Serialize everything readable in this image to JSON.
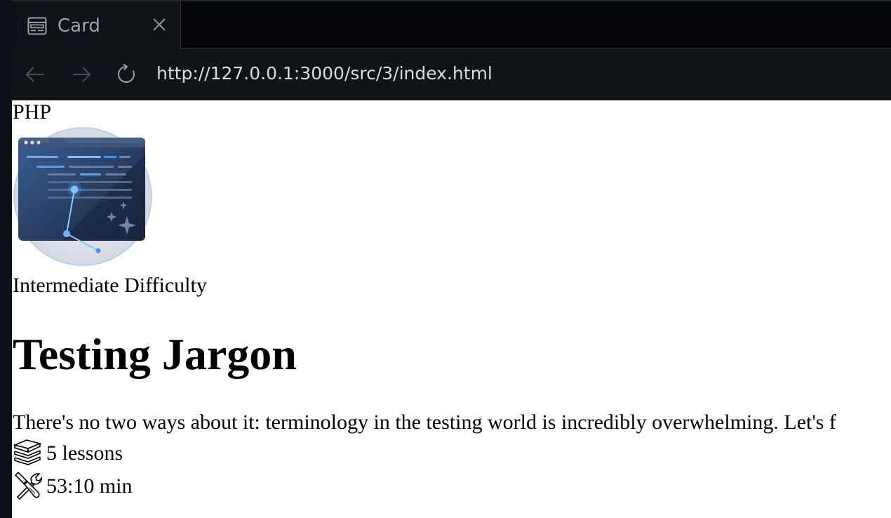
{
  "browser": {
    "tab": {
      "title": "Card",
      "icon": "webpage-layout-icon",
      "close_icon": "close-icon"
    },
    "toolbar": {
      "back_icon": "arrow-left-icon",
      "forward_icon": "arrow-right-icon",
      "reload_icon": "reload-icon",
      "url": "http://127.0.0.1:3000/src/3/index.html"
    }
  },
  "card": {
    "category": "PHP",
    "image_icon": "code-editor-illustration",
    "difficulty": "Intermediate Difficulty",
    "title": "Testing Jargon",
    "description": "There's no two ways about it: terminology in the testing world is incredibly overwhelming. Let's f",
    "meta": {
      "lessons": {
        "icon": "books-icon",
        "text": "5 lessons"
      },
      "duration": {
        "icon": "tools-icon",
        "text": "53:10 min"
      }
    }
  }
}
